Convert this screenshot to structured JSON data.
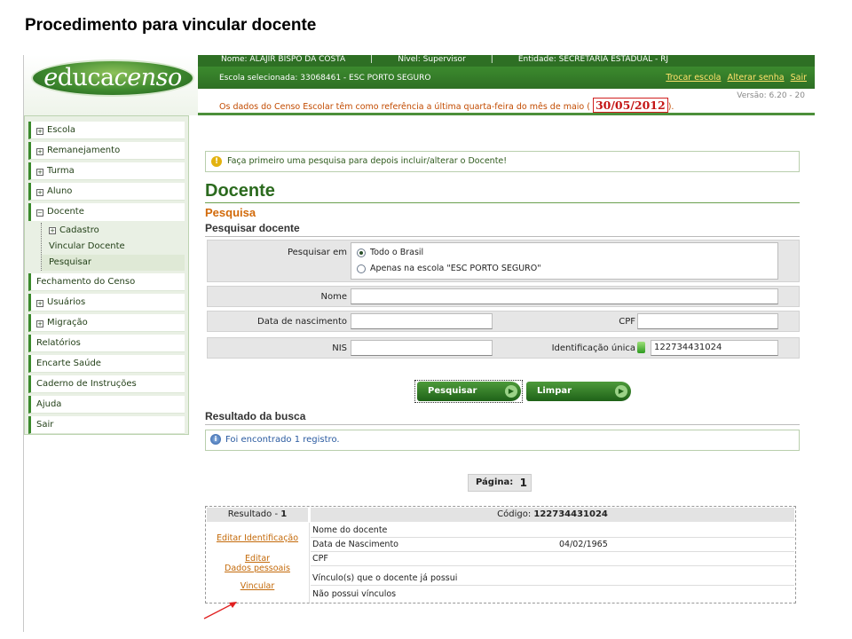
{
  "slide_title": "Procedimento para vincular docente",
  "header": {
    "logo_prefix": "e",
    "logo_mid": "duca",
    "logo_suffix": "censo",
    "user_line": [
      "Nome: ALAJIR BISPO DA COSTA",
      "|",
      "Nível: Supervisor",
      "|",
      "Entidade: SECRETARIA ESTADUAL - RJ"
    ],
    "school_selected": "Escola selecionada: 33068461 - ESC PORTO SEGURO",
    "links": {
      "trocar_escola": "Trocar escola",
      "alterar_senha": "Alterar senha",
      "sair": "Sair"
    },
    "notice_text": "Os dados do Censo Escolar têm como referência a última quarta-feira do mês de maio (",
    "notice_date": "30/05/2012",
    "notice_end": ").",
    "version": "Versão: 6.20 - 20"
  },
  "sidebar": {
    "items": [
      {
        "label": "Escola",
        "toggle": "+"
      },
      {
        "label": "Remanejamento",
        "toggle": "+"
      },
      {
        "label": "Turma",
        "toggle": "+"
      },
      {
        "label": "Aluno",
        "toggle": "+"
      },
      {
        "label": "Docente",
        "toggle": "−"
      }
    ],
    "docente_sub": {
      "cadastro": "Cadastro",
      "cadastro_toggle": "+",
      "vincular": "Vincular Docente",
      "pesquisar": "Pesquisar"
    },
    "items2": [
      {
        "label": "Fechamento do Censo",
        "toggle": ""
      },
      {
        "label": "Usuários",
        "toggle": "+"
      },
      {
        "label": "Migração",
        "toggle": "+"
      },
      {
        "label": "Relatórios",
        "toggle": ""
      },
      {
        "label": "Encarte Saúde",
        "toggle": ""
      },
      {
        "label": "Caderno de Instruções",
        "toggle": ""
      },
      {
        "label": "Ajuda",
        "toggle": ""
      },
      {
        "label": "Sair",
        "toggle": ""
      }
    ]
  },
  "main": {
    "alert": "Faça primeiro uma pesquisa para depois incluir/alterar o Docente!",
    "title": "Docente",
    "subtitle": "Pesquisa",
    "search_section": "Pesquisar docente",
    "form": {
      "pesquisar_em_label": "Pesquisar em",
      "opt_brasil": "Todo o Brasil",
      "opt_escola": "Apenas na escola \"ESC PORTO SEGURO\"",
      "nome_label": "Nome",
      "nome_value": "",
      "nasc_label": "Data de nascimento",
      "nasc_value": "",
      "cpf_label": "CPF",
      "cpf_value": "",
      "nis_label": "NIS",
      "nis_value": "",
      "id_label": "Identificação única",
      "id_value": "122734431024"
    },
    "btn_pesquisar": "Pesquisar",
    "btn_limpar": "Limpar",
    "result_section": "Resultado da busca",
    "info": "Foi encontrado 1 registro.",
    "pager_label": "Página:",
    "pager_value": "1",
    "result": {
      "label": "Resultado - ",
      "number": "1",
      "code_label": "Código: ",
      "code_value": "122734431024",
      "link_editar_id": "Editar Identificação",
      "link_editar": "Editar",
      "link_dados": "Dados pessoais",
      "link_vincular": "Vincular",
      "row_nome": "Nome do docente",
      "row_nasc": "Data de Nascimento",
      "row_nasc_value": "04/02/1965",
      "row_cpf": "CPF",
      "row_vinculos": "Vínculo(s) que o docente já possui",
      "row_sem_vinculos": "Não possui vínculos"
    }
  },
  "colors": {
    "brand_green": "#2e6f24",
    "accent_orange": "#d26a0a",
    "date_red": "#c41616"
  }
}
